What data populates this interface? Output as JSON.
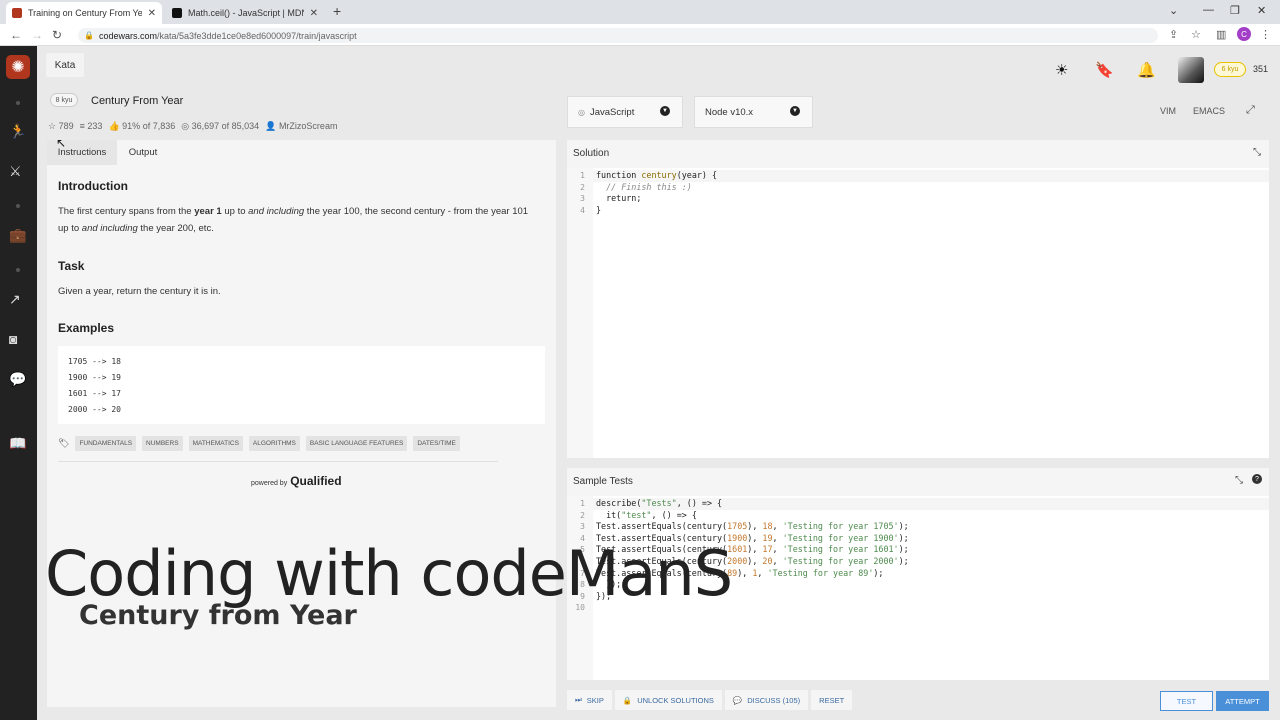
{
  "browser": {
    "tabs": [
      {
        "title": "Training on Century From Year | C",
        "active": true,
        "favicon_color": "#b1361e"
      },
      {
        "title": "Math.ceil() - JavaScript | MDN",
        "active": false,
        "favicon_color": "#111111"
      }
    ],
    "url_host": "codewars.com",
    "url_path": "/kata/5a3fe3dde1ce0e8ed6000097/train/javascript",
    "profile_initial": "C"
  },
  "header": {
    "kata_tab": "Kata",
    "rank_badge": "6 kyu",
    "honor": "351"
  },
  "kata": {
    "kyu": "8 kyu",
    "title": "Century From Year",
    "stats": {
      "stars": "789",
      "collections": "233",
      "satisfaction": "91%",
      "satisfaction_of": "of 7,836",
      "completed": "36,697",
      "completed_of": "of 85,034",
      "author": "MrZizoScream"
    }
  },
  "description": {
    "tabs": [
      "Instructions",
      "Output"
    ],
    "intro_heading": "Introduction",
    "intro_text": [
      {
        "t": "The first century spans from the ",
        "s": ""
      },
      {
        "t": "year 1",
        "s": "b"
      },
      {
        "t": " up to ",
        "s": ""
      },
      {
        "t": "and including",
        "s": "i"
      },
      {
        "t": " the year 100, the second century - from the year 101 up to ",
        "s": ""
      },
      {
        "t": "and including",
        "s": "i"
      },
      {
        "t": " the year 200, etc.",
        "s": ""
      }
    ],
    "task_heading": "Task",
    "task_text": "Given a year, return the century it is in.",
    "examples_heading": "Examples",
    "examples": [
      "1705 --> 18",
      "1900 --> 19",
      "1601 --> 17",
      "2000 --> 20"
    ],
    "tags": [
      "FUNDAMENTALS",
      "NUMBERS",
      "MATHEMATICS",
      "ALGORITHMS",
      "BASIC LANGUAGE FEATURES",
      "DATES/TIME"
    ],
    "powered_by": "powered by",
    "powered_brand": "Qualified"
  },
  "editor": {
    "language": "JavaScript",
    "runtime": "Node v10.x",
    "modes": [
      "VIM",
      "EMACS"
    ],
    "solution_title": "Solution",
    "solution_code": [
      [
        [
          "kw",
          "function "
        ],
        [
          "fn",
          "century"
        ],
        [
          "kw",
          "(year) {"
        ]
      ],
      [
        [
          "cm",
          "  // Finish this :)"
        ]
      ],
      [
        [
          "kw",
          "  return;"
        ]
      ],
      [
        [
          "kw",
          "}"
        ]
      ]
    ],
    "tests_title": "Sample Tests",
    "tests_code": [
      [
        [
          "kw",
          "describe("
        ],
        [
          "st",
          "\"Tests\""
        ],
        [
          "kw",
          ", () => {"
        ]
      ],
      [
        [
          "kw",
          "  it("
        ],
        [
          "st",
          "\"test\""
        ],
        [
          "kw",
          ", () => {"
        ]
      ],
      [
        [
          "kw",
          "Test.assertEquals(century("
        ],
        [
          "nm",
          "1705"
        ],
        [
          "kw",
          "), "
        ],
        [
          "nm",
          "18"
        ],
        [
          "kw",
          ", "
        ],
        [
          "st",
          "'Testing for year 1705'"
        ],
        [
          "kw",
          ");"
        ]
      ],
      [
        [
          "kw",
          "Test.assertEquals(century("
        ],
        [
          "nm",
          "1900"
        ],
        [
          "kw",
          "), "
        ],
        [
          "nm",
          "19"
        ],
        [
          "kw",
          ", "
        ],
        [
          "st",
          "'Testing for year 1900'"
        ],
        [
          "kw",
          ");"
        ]
      ],
      [
        [
          "kw",
          "Test.assertEquals(century("
        ],
        [
          "nm",
          "1601"
        ],
        [
          "kw",
          "), "
        ],
        [
          "nm",
          "17"
        ],
        [
          "kw",
          ", "
        ],
        [
          "st",
          "'Testing for year 1601'"
        ],
        [
          "kw",
          ");"
        ]
      ],
      [
        [
          "kw",
          "Test.assertEquals(century("
        ],
        [
          "nm",
          "2000"
        ],
        [
          "kw",
          "), "
        ],
        [
          "nm",
          "20"
        ],
        [
          "kw",
          ", "
        ],
        [
          "st",
          "'Testing for year 2000'"
        ],
        [
          "kw",
          ");"
        ]
      ],
      [
        [
          "kw",
          "Test.assertEquals(century("
        ],
        [
          "nm",
          "89"
        ],
        [
          "kw",
          "), "
        ],
        [
          "nm",
          "1"
        ],
        [
          "kw",
          ", "
        ],
        [
          "st",
          "'Testing for year 89'"
        ],
        [
          "kw",
          ");"
        ]
      ],
      [
        [
          "kw",
          "  });"
        ]
      ],
      [
        [
          "kw",
          "});"
        ]
      ],
      [
        [
          "kw",
          ""
        ]
      ]
    ]
  },
  "footer": {
    "skip": "SKIP",
    "unlock": "UNLOCK SOLUTIONS",
    "discuss": "DISCUSS (105)",
    "reset": "RESET",
    "test": "TEST",
    "attempt": "ATTEMPT"
  },
  "overlay": {
    "line1": "Coding with codeManS",
    "line2": "Century from Year"
  },
  "colors": {
    "accent": "#4a90d9",
    "brand": "#b1361e",
    "rank": "#e6c200"
  }
}
